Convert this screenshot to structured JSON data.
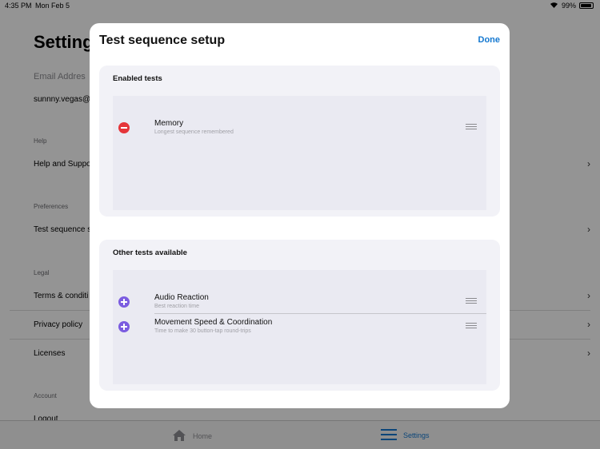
{
  "status_bar": {
    "time": "4:35 PM",
    "date": "Mon Feb 5",
    "battery": "99%"
  },
  "background": {
    "title": "Setting",
    "email_label": "Email Addres",
    "email_value": "sunnny.vegas@",
    "sections": [
      {
        "header": "Help",
        "items": [
          "Help and Suppo"
        ]
      },
      {
        "header": "Preferences",
        "items": [
          "Test sequence s"
        ]
      },
      {
        "header": "Legal",
        "items": [
          "Terms & conditi",
          "Privacy policy",
          "Licenses"
        ]
      },
      {
        "header": "Account",
        "items": [
          "Logout"
        ]
      }
    ]
  },
  "tab_bar": {
    "home_label": "Home",
    "settings_label": "Settings",
    "active_color": "#1478d0"
  },
  "modal": {
    "title": "Test sequence setup",
    "done_label": "Done",
    "enabled": {
      "header": "Enabled tests",
      "items": [
        {
          "name": "Memory",
          "subtitle": "Longest sequence remembered",
          "icon": "minus-circle-icon"
        }
      ]
    },
    "available": {
      "header": "Other tests available",
      "items": [
        {
          "name": "Audio Reaction",
          "subtitle": "Best reaction time",
          "icon": "plus-circle-icon"
        },
        {
          "name": "Movement Speed & Coordination",
          "subtitle": "Time to make 30 button-tap round-trips",
          "icon": "plus-circle-icon"
        }
      ]
    }
  },
  "colors": {
    "remove": "#e5353a",
    "add": "#7b5ce0",
    "accent": "#1478d0"
  }
}
